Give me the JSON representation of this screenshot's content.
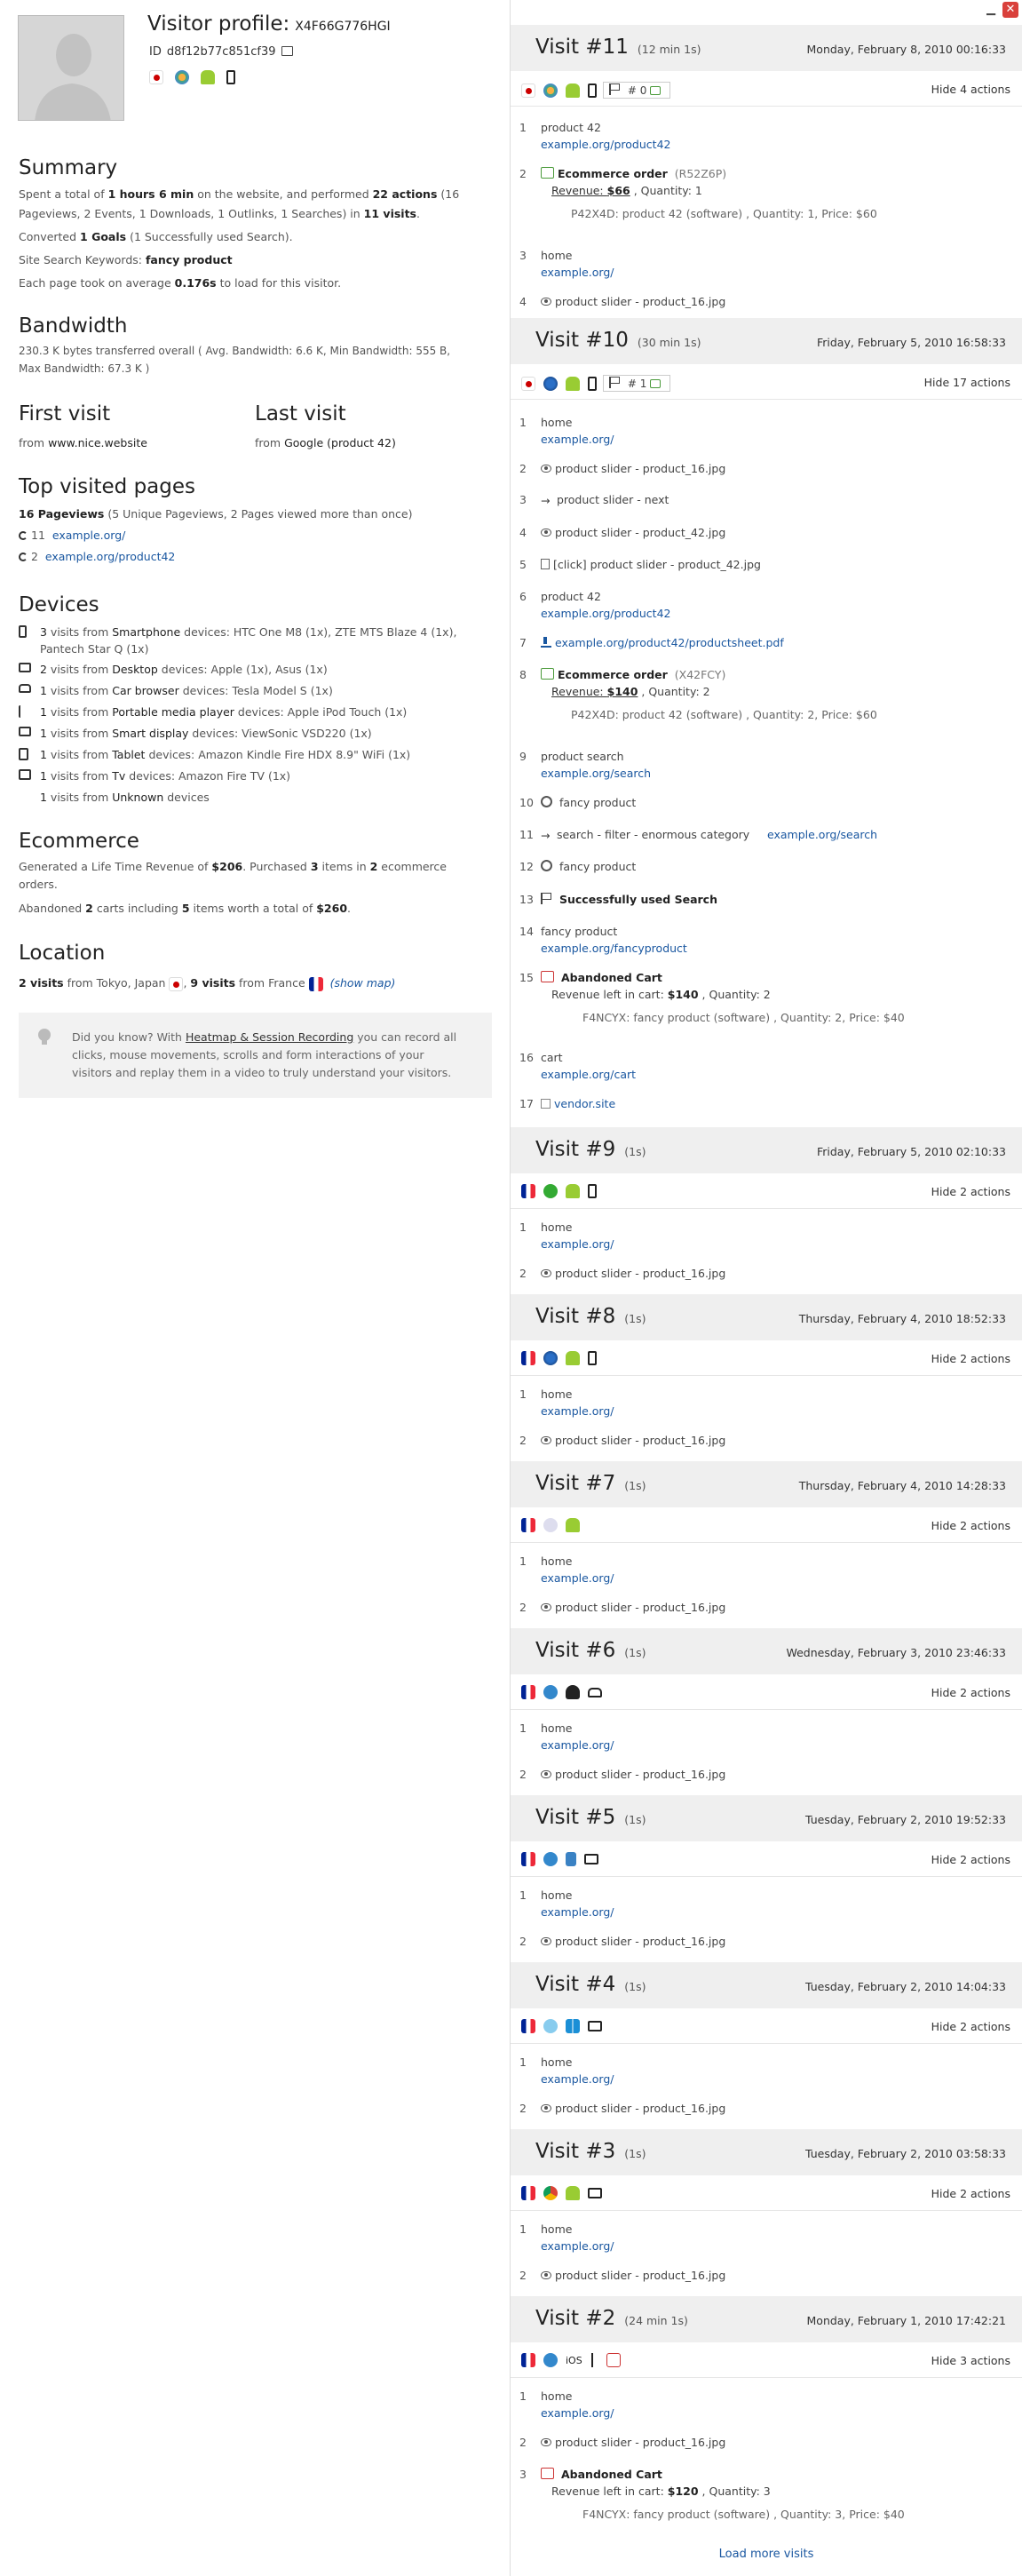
{
  "header": {
    "title": "Visitor profile:",
    "visitor_id": "X4F66G776HGI",
    "id_label": "ID",
    "id_value": "d8f12b77c851cf39"
  },
  "summary": {
    "heading": "Summary",
    "line1_a": "Spent a total of ",
    "line1_b": "1 hours 6 min",
    "line1_c": " on the website, and performed ",
    "line1_d": "22 actions",
    "line1_e": " (16",
    "line2_a": "Pageviews, 2 Events, 1 Downloads, 1 Outlinks, 1 Searches) in ",
    "line2_b": "11 visits",
    "line2_c": ".",
    "goals_a": "Converted ",
    "goals_b": "1 Goals",
    "goals_c": " (1 Successfully used Search).",
    "keywords_a": "Site Search Keywords: ",
    "keywords_b": "fancy product",
    "load_a": "Each page took on average ",
    "load_b": "0.176s",
    "load_c": " to load for this visitor."
  },
  "bandwidth": {
    "heading": "Bandwidth",
    "line1": "230.3 K bytes transferred overall ( Avg. Bandwidth: 6.6 K, Min Bandwidth: 555 B,",
    "line2": "Max Bandwidth: 67.3 K )"
  },
  "first_visit": {
    "heading": "First visit",
    "from": "from ",
    "value": "www.nice.website"
  },
  "last_visit": {
    "heading": "Last visit",
    "from": "from ",
    "value": "Google (product 42)"
  },
  "top_pages": {
    "heading": "Top visited pages",
    "count": "16 Pageviews",
    "detail": " (5 Unique Pageviews, 2 Pages viewed more than once)",
    "items": [
      {
        "count": "11",
        "url": "example.org/"
      },
      {
        "count": "2",
        "url": "example.org/product42"
      }
    ]
  },
  "devices": {
    "heading": "Devices",
    "rows": [
      {
        "n": "3",
        "a": " visits from ",
        "type": "Smartphone",
        "b": " devices: HTC One M8 (1x), ZTE MTS Blaze 4 (1x),",
        "c": "Pantech Star Q (1x)"
      },
      {
        "n": "2",
        "a": " visits from ",
        "type": "Desktop",
        "b": " devices: Apple (1x), Asus (1x)"
      },
      {
        "n": "1",
        "a": " visits from ",
        "type": "Car browser",
        "b": " devices: Tesla Model S (1x)"
      },
      {
        "n": "1",
        "a": " visits from ",
        "type": "Portable media player",
        "b": " devices: Apple iPod Touch (1x)"
      },
      {
        "n": "1",
        "a": " visits from ",
        "type": "Smart display",
        "b": " devices: ViewSonic VSD220 (1x)"
      },
      {
        "n": "1",
        "a": " visits from ",
        "type": "Tablet",
        "b": " devices: Amazon Kindle Fire HDX 8.9\" WiFi (1x)"
      },
      {
        "n": "1",
        "a": " visits from ",
        "type": "Tv",
        "b": " devices: Amazon Fire TV (1x)"
      },
      {
        "n": "1",
        "a": " visits from ",
        "type": "Unknown",
        "b": " devices"
      }
    ]
  },
  "ecommerce": {
    "heading": "Ecommerce",
    "l1a": "Generated a Life Time Revenue of ",
    "l1b": "$206",
    "l1c": ". Purchased ",
    "l1d": "3",
    "l1e": " items in ",
    "l1f": "2",
    "l1g": " ecommerce",
    "l2": "orders.",
    "l3a": "Abandoned ",
    "l3b": "2",
    "l3c": " carts including ",
    "l3d": "5",
    "l3e": " items worth a total of ",
    "l3f": "$260",
    "l3g": "."
  },
  "location": {
    "heading": "Location",
    "a": "2 visits",
    "b": " from Tokyo, Japan ",
    "c": ", ",
    "d": "9 visits",
    "e": " from France ",
    "map": "(show map)"
  },
  "tip": {
    "a": "Did you know? With ",
    "link": "Heatmap & Session Recording",
    "b": " you can record all",
    "c": "clicks, mouse movements, scrolls and form interactions of your",
    "d": "visitors and replay them in a video to truly understand your visitors."
  },
  "visits": [
    {
      "title": "Visit #11",
      "dur": "(12 min 1s)",
      "date": "Monday, February 8, 2010 00:16:33",
      "hide": "Hide 4 actions",
      "goal": "# 0"
    },
    {
      "title": "Visit #10",
      "dur": "(30 min 1s)",
      "date": "Friday, February 5, 2010 16:58:33",
      "hide": "Hide 17 actions",
      "goal": "# 1"
    },
    {
      "title": "Visit #9",
      "dur": "(1s)",
      "date": "Friday, February 5, 2010 02:10:33",
      "hide": "Hide 2 actions"
    },
    {
      "title": "Visit #8",
      "dur": "(1s)",
      "date": "Thursday, February 4, 2010 18:52:33",
      "hide": "Hide 2 actions"
    },
    {
      "title": "Visit #7",
      "dur": "(1s)",
      "date": "Thursday, February 4, 2010 14:28:33",
      "hide": "Hide 2 actions"
    },
    {
      "title": "Visit #6",
      "dur": "(1s)",
      "date": "Wednesday, February 3, 2010 23:46:33",
      "hide": "Hide 2 actions"
    },
    {
      "title": "Visit #5",
      "dur": "(1s)",
      "date": "Tuesday, February 2, 2010 19:52:33",
      "hide": "Hide 2 actions"
    },
    {
      "title": "Visit #4",
      "dur": "(1s)",
      "date": "Tuesday, February 2, 2010 14:04:33",
      "hide": "Hide 2 actions"
    },
    {
      "title": "Visit #3",
      "dur": "(1s)",
      "date": "Tuesday, February 2, 2010 03:58:33",
      "hide": "Hide 2 actions"
    },
    {
      "title": "Visit #2",
      "dur": "(24 min 1s)",
      "date": "Monday, February 1, 2010 17:42:21",
      "hide": "Hide 3 actions",
      "os_label": "iOS"
    }
  ],
  "actions": {
    "home": "home",
    "home_url": "example.org/",
    "slider16": "product slider - product_16.jpg",
    "slider42": "product slider - product_42.jpg",
    "slider_next": "product slider - next",
    "click42": "[click] product slider - product_42.jpg",
    "product42": "product 42",
    "product42_url": "example.org/product42",
    "pdf_url": "example.org/product42/productsheet.pdf",
    "ecom_order": "Ecommerce order",
    "order1_id": "(R52Z6P)",
    "order2_id": "(X42FCY)",
    "revenue_label": "Revenue: ",
    "order1_rev": "$66",
    "order1_qty": " , Quantity: 1",
    "order1_prod": "P42X4D: product 42 (software) , Quantity: 1, Price: $60",
    "order2_rev": "$140",
    "order2_qty": " , Quantity: 2",
    "order2_prod": "P42X4D: product 42 (software) , Quantity: 2, Price: $60",
    "search_page": "product search",
    "search_url": "example.org/search",
    "fancy": "fancy product",
    "filter": "search - filter - enormous category",
    "success_search": "Successfully used Search",
    "fancy_url": "example.org/fancyproduct",
    "abandoned": "Abandoned Cart",
    "cart_left": "Revenue left in cart: ",
    "cart1_rev": "$140",
    "cart1_qty": " , Quantity: 2",
    "cart1_prod": "F4NCYX: fancy product (software) , Quantity: 2, Price: $40",
    "cart_page": "cart",
    "cart_url": "example.org/cart",
    "vendor": "vendor.site",
    "cart2_rev": "$120",
    "cart2_qty": " , Quantity: 3",
    "cart2_prod": "F4NCYX: fancy product (software) , Quantity: 3, Price: $40"
  },
  "load_more": "Load more visits",
  "colors": {
    "link": "#1a57a0",
    "close": "#d9403b",
    "header_bg": "#efefef"
  }
}
